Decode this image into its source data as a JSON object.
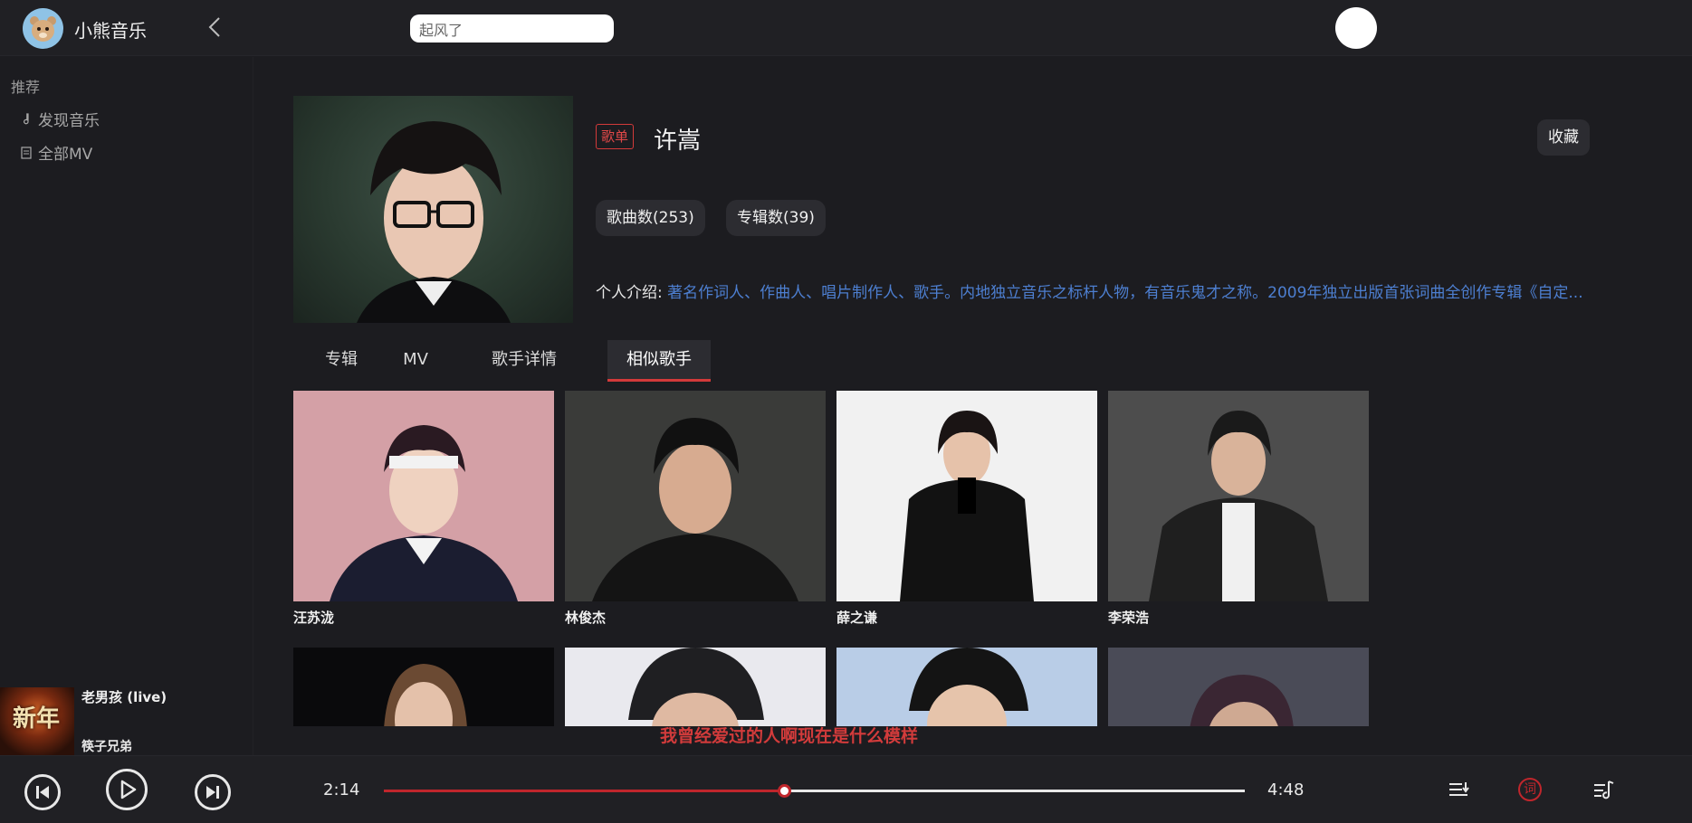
{
  "app": {
    "name": "小熊音乐"
  },
  "search": {
    "value": "起风了"
  },
  "sidebar": {
    "section": "推荐",
    "items": [
      {
        "label": "发现音乐",
        "icon": "music-note-icon"
      },
      {
        "label": "全部MV",
        "icon": "document-icon"
      }
    ]
  },
  "now_playing": {
    "title": "老男孩 (live)",
    "artist": "筷子兄弟",
    "cover_text": "新年"
  },
  "artist": {
    "tag": "歌单",
    "name": "许嵩",
    "favorite_label": "收藏",
    "song_count": "歌曲数(253)",
    "album_count": "专辑数(39)",
    "intro_label": "个人介绍:",
    "intro_text": "著名作词人、作曲人、唱片制作人、歌手。内地独立音乐之标杆人物，有音乐鬼才之称。2009年独立出版首张词曲全创作专辑《自定..."
  },
  "tabs": [
    {
      "label": "专辑",
      "active": false
    },
    {
      "label": "MV",
      "active": false
    },
    {
      "label": "歌手详情",
      "active": false
    },
    {
      "label": "相似歌手",
      "active": true
    }
  ],
  "similar_artists": [
    {
      "name": "汪苏泷"
    },
    {
      "name": "林俊杰"
    },
    {
      "name": "薛之谦"
    },
    {
      "name": "李荣浩"
    },
    {
      "name": ""
    },
    {
      "name": ""
    },
    {
      "name": ""
    },
    {
      "name": ""
    }
  ],
  "lyric": "我曾经爱过的人啊现在是什么模样",
  "player": {
    "current_time": "2:14",
    "total_time": "4:48",
    "progress": 0.465,
    "lyric_button": "词",
    "accent": "#c0262c"
  }
}
